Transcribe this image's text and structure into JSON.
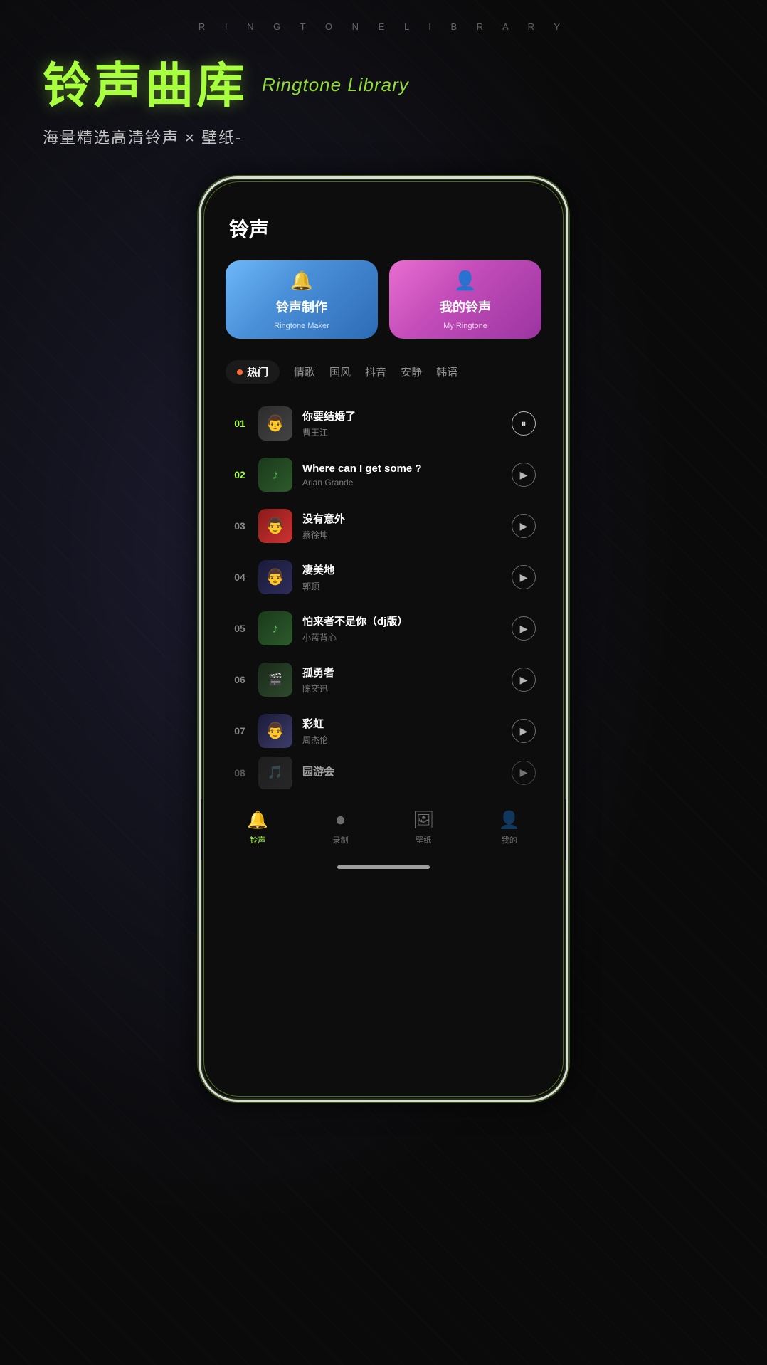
{
  "top_label": "R I N G T O N E   L I B R A R Y",
  "header": {
    "title_cn": "铃声曲库",
    "title_en": "Ringtone Library",
    "subtitle": "海量精选高清铃声 × 壁纸-"
  },
  "page_title": "铃声",
  "cards": [
    {
      "id": "maker",
      "icon": "🔔",
      "label_cn": "铃声制作",
      "label_en": "Ringtone Maker"
    },
    {
      "id": "my",
      "icon": "👤",
      "label_cn": "我的铃声",
      "label_en": "My Ringtone"
    }
  ],
  "tabs": [
    {
      "id": "hot",
      "label": "热门",
      "active": true
    },
    {
      "id": "love",
      "label": "情歌",
      "active": false
    },
    {
      "id": "national",
      "label": "国风",
      "active": false
    },
    {
      "id": "douyin",
      "label": "抖音",
      "active": false
    },
    {
      "id": "quiet",
      "label": "安静",
      "active": false
    },
    {
      "id": "korean",
      "label": "韩语",
      "active": false
    }
  ],
  "songs": [
    {
      "num": "01",
      "name": "你要结婚了",
      "artist": "曹王江",
      "playing": true,
      "thumb_class": "thumb-01",
      "thumb_emoji": "👨"
    },
    {
      "num": "02",
      "name": "Where can I get some ?",
      "artist": "Arian Grande",
      "playing": false,
      "thumb_class": "thumb-02",
      "thumb_emoji": "🎵"
    },
    {
      "num": "03",
      "name": "没有意外",
      "artist": "蔡徐坤",
      "playing": false,
      "thumb_class": "thumb-03",
      "thumb_emoji": "👨"
    },
    {
      "num": "04",
      "name": "凄美地",
      "artist": "郭顶",
      "playing": false,
      "thumb_class": "thumb-04",
      "thumb_emoji": "👨"
    },
    {
      "num": "05",
      "name": "怕来者不是你（dj版）",
      "artist": "小蓝背心",
      "playing": false,
      "thumb_class": "thumb-05",
      "thumb_emoji": "🎵"
    },
    {
      "num": "06",
      "name": "孤勇者",
      "artist": "陈奕迅",
      "playing": false,
      "thumb_class": "thumb-06",
      "thumb_emoji": "🎬"
    },
    {
      "num": "07",
      "name": "彩虹",
      "artist": "周杰伦",
      "playing": false,
      "thumb_class": "thumb-07",
      "thumb_emoji": "👨"
    },
    {
      "num": "08",
      "name": "园游会",
      "artist": "",
      "playing": false,
      "thumb_class": "thumb-08",
      "thumb_emoji": "🎵",
      "partial": true
    }
  ],
  "nav_items": [
    {
      "id": "ringtone",
      "icon": "🔔",
      "label": "铃声",
      "active": true
    },
    {
      "id": "record",
      "icon": "⏺",
      "label": "录制",
      "active": false
    },
    {
      "id": "wallpaper",
      "icon": "🖼",
      "label": "壁纸",
      "active": false
    },
    {
      "id": "mine",
      "icon": "👤",
      "label": "我的",
      "active": false
    }
  ]
}
